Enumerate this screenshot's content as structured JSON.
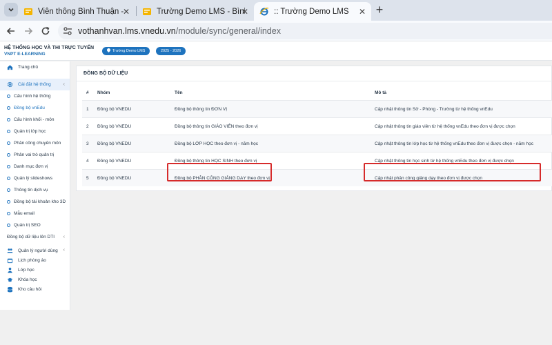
{
  "browser": {
    "tabs": [
      {
        "title": "Viễn thông Bình Thuận - Bình T",
        "icon": "bookmark-icon",
        "active": false
      },
      {
        "title": "Trường Demo LMS - Bình Thuậ",
        "icon": "bookmark-icon",
        "active": false
      },
      {
        "title": ":: Trường Demo LMS",
        "icon": "ie-logo-icon",
        "active": true
      }
    ],
    "new_tab_label": "+",
    "url_host": "vothanhvan.lms.vnedu.vn",
    "url_path": "/module/sync/general/index"
  },
  "header": {
    "title": "HỆ THỐNG HỌC VÀ THI TRỰC TUYẾN",
    "subtitle": "VNPT E-LEARNING",
    "school_pill": "Trường Demo LMS",
    "year_pill": "2025 - 2026"
  },
  "sidebar": {
    "items": [
      {
        "label": "Trang chủ",
        "icon": "home-icon"
      },
      {
        "label": "Cài đặt hệ thống",
        "icon": "gear-icon"
      },
      {
        "label": "Cấu hình hệ thống"
      },
      {
        "label": "Đồng bộ vnEdu"
      },
      {
        "label": "Cấu hình khối - môn"
      },
      {
        "label": "Quản trị lớp học"
      },
      {
        "label": "Phân công chuyên môn"
      },
      {
        "label": "Phân vai trò quản trị"
      },
      {
        "label": "Danh mục đơn vị"
      },
      {
        "label": "Quản lý slideshows"
      },
      {
        "label": "Thông tin dịch vụ"
      },
      {
        "label": "Đồng bộ tài khoản kho 3D"
      },
      {
        "label": "Mẫu email"
      },
      {
        "label": "Quản trị SEO"
      },
      {
        "label": "Đồng bộ dữ liệu lên DTI"
      },
      {
        "label": "Quản lý người dùng",
        "icon": "users-icon"
      },
      {
        "label": "Lịch phòng ảo",
        "icon": "calendar-icon"
      },
      {
        "label": "Lớp học",
        "icon": "user-icon"
      },
      {
        "label": "Khóa học",
        "icon": "graduation-cap-icon"
      },
      {
        "label": "Kho câu hỏi",
        "icon": "database-icon"
      }
    ]
  },
  "main": {
    "title": "ĐỒNG BỘ DỮ LIỆU",
    "columns": [
      "#",
      "Nhóm",
      "Tên",
      "Mô tả"
    ],
    "rows": [
      {
        "num": "1",
        "group": "Đồng bộ VNEDU",
        "name": "Đồng bộ thông tin ĐƠN VỊ",
        "desc": "Cập nhật thông tin Sở - Phòng - Trường từ hệ thống vnEdu"
      },
      {
        "num": "2",
        "group": "Đồng bộ VNEDU",
        "name": "Đồng bộ thông tin GIÁO VIÊN theo đơn vị",
        "desc": "Cập nhật thông tin giáo viên từ hệ thống vnEdu theo đơn vị được chọn"
      },
      {
        "num": "3",
        "group": "Đồng bộ VNEDU",
        "name": "Đồng bộ LỚP HỌC theo đơn vị - năm học",
        "desc": "Cập nhật thông tin lớp học từ hệ thống vnEdu theo đơn vị được chọn - năm học"
      },
      {
        "num": "4",
        "group": "Đồng bộ VNEDU",
        "name": "Đồng bộ thông tin HỌC SINH theo đơn vị",
        "desc": "Cập nhật thông tin học sinh từ hệ thống vnEdu theo đơn vị được chọn"
      },
      {
        "num": "5",
        "group": "Đồng bộ VNEDU",
        "name": "Đồng bộ PHÂN CÔNG GIẢNG DẠY theo đơn vị",
        "desc": "Cập nhật phân công giảng dạy theo đơn vị được chọn"
      }
    ]
  },
  "colors": {
    "accent": "#1e73be",
    "highlight": "#d62b2b"
  }
}
